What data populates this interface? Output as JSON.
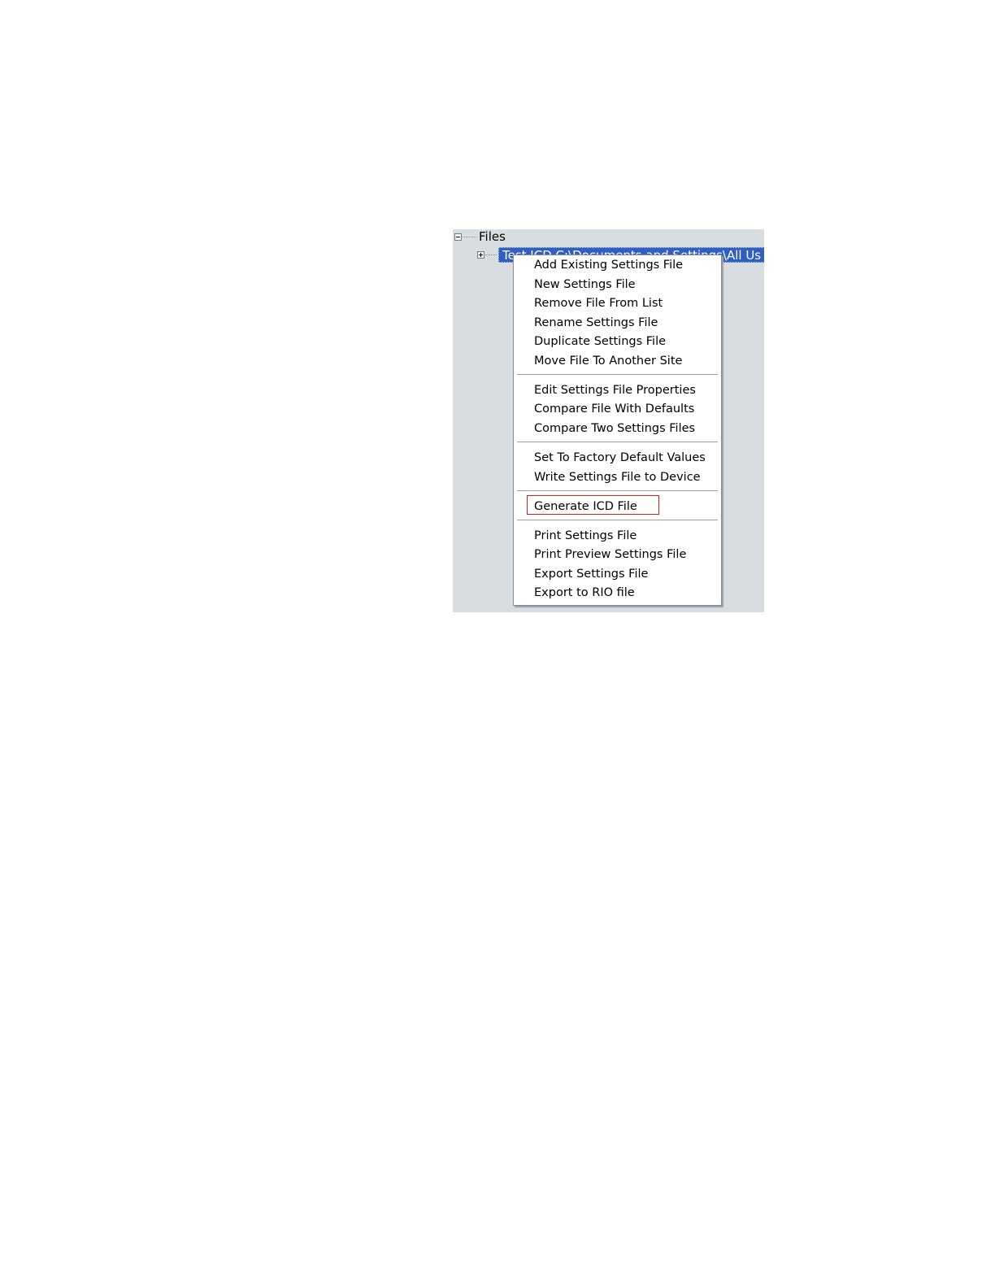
{
  "tree": {
    "root_label": "Files",
    "child_label": "Test ICD C:\\Documents and Settings\\All Us"
  },
  "menu": {
    "groups": [
      [
        "Add Existing Settings File",
        "New Settings File",
        "Remove File From List",
        "Rename Settings File",
        "Duplicate Settings File",
        "Move File To Another Site"
      ],
      [
        "Edit Settings File Properties",
        "Compare File With Defaults",
        "Compare Two Settings Files"
      ],
      [
        "Set To Factory Default Values",
        "Write Settings File to Device"
      ],
      [
        "Generate ICD File"
      ],
      [
        "Print Settings File",
        "Print Preview Settings File",
        "Export Settings File",
        "Export to RIO file"
      ]
    ],
    "highlighted_item": "Generate ICD File",
    "highlight_color": "#d42020"
  },
  "colors": {
    "selection": "#2f5ec7",
    "panel_background": "#d8dde2"
  }
}
